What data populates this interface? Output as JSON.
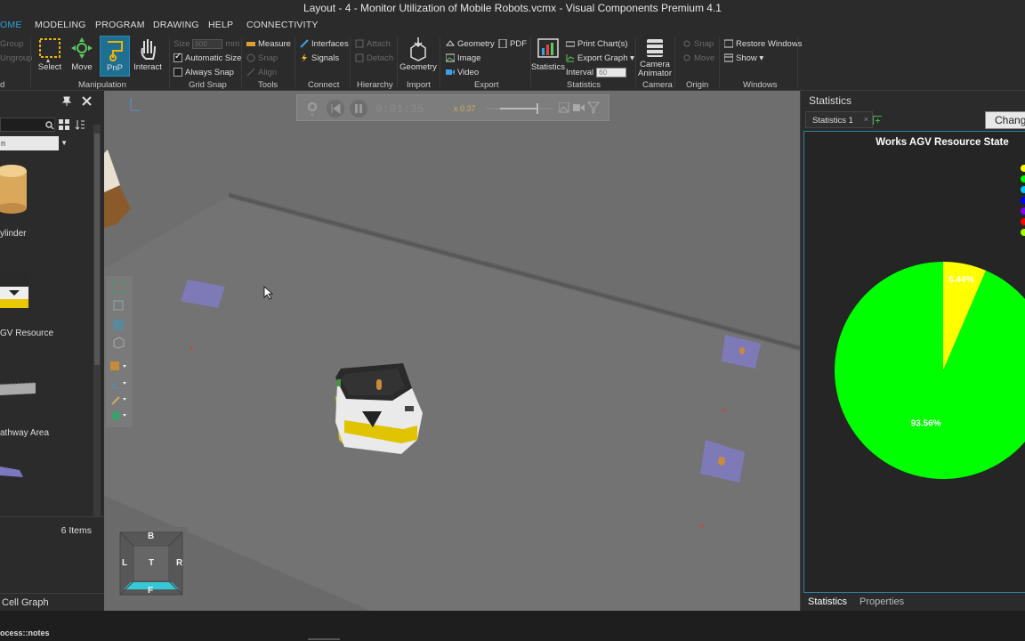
{
  "window": {
    "title": "Layout - 4 - Monitor Utilization of Mobile Robots.vcmx - Visual Components Premium 4.1"
  },
  "menu": {
    "tabs": [
      {
        "label": "OME"
      },
      {
        "label": "MODELING"
      },
      {
        "label": "PROGRAM"
      },
      {
        "label": "DRAWING"
      },
      {
        "label": "HELP"
      },
      {
        "label": "CONNECTIVITY"
      }
    ]
  },
  "ribbon": {
    "clipboard": {
      "group_label": "d",
      "group": "Group",
      "ungroup": "Ungroup"
    },
    "manipulation": {
      "group_label": "Manipulation",
      "select": "Select",
      "move": "Move",
      "pnp": "PnP",
      "interact": "Interact"
    },
    "grid_snap": {
      "group_label": "Grid Snap",
      "size_label": "Size",
      "size_value": "500",
      "size_unit": "mm",
      "automatic_size": "Automatic Size",
      "always_snap": "Always Snap"
    },
    "tools": {
      "group_label": "Tools",
      "measure": "Measure",
      "snap": "Snap",
      "align": "Align"
    },
    "connect": {
      "group_label": "Connect",
      "interfaces": "Interfaces",
      "signals": "Signals"
    },
    "hierarchy": {
      "group_label": "Hierarchy",
      "attach": "Attach",
      "detach": "Detach"
    },
    "import": {
      "group_label": "Import",
      "geometry": "Geometry"
    },
    "export": {
      "group_label": "Export",
      "geometry": "Geometry",
      "pdf": "PDF",
      "image": "Image",
      "video": "Video"
    },
    "statistics": {
      "group_label": "Statistics",
      "statistics": "Statistics",
      "print_charts": "Print Chart(s)",
      "export_graph": "Export Graph ▾",
      "interval_label": "Interval",
      "interval_value": "60",
      "interval_unit": "s"
    },
    "camera": {
      "group_label": "Camera",
      "camera_animator_line1": "Camera",
      "camera_animator_line2": "Animator"
    },
    "origin": {
      "group_label": "Origin",
      "snap": "Snap",
      "move": "Move"
    },
    "windows": {
      "group_label": "Windows",
      "restore_windows": "Restore Windows",
      "show": "Show ▾"
    }
  },
  "library": {
    "dropdown_value": "n",
    "items": [
      {
        "label": "ylinder"
      },
      {
        "label": "GV Resource"
      },
      {
        "label": "athway Area"
      }
    ],
    "items_count": "6 Items",
    "cell_graph": "Cell Graph"
  },
  "simulation": {
    "time": "0:01:35",
    "speed": "x 0.37"
  },
  "navcube": {
    "back": "B",
    "left": "L",
    "top": "T",
    "right": "R",
    "front": "F"
  },
  "statistics_panel": {
    "title": "Statistics",
    "tab_label": "Statistics 1",
    "change_button": "Chang",
    "bottom_tabs": [
      {
        "label": "Statistics"
      },
      {
        "label": "Properties"
      }
    ]
  },
  "chart_data": {
    "type": "pie",
    "title": "Works AGV Resource State",
    "slices": [
      {
        "value": 93.56,
        "label": "93.56%",
        "color": "#00ff00"
      },
      {
        "value": 6.44,
        "label": "6.44%",
        "color": "#ffff00"
      }
    ],
    "legend_colors": [
      "#ffff00",
      "#00ff00",
      "#00c8ff",
      "#0000ff",
      "#8000ff",
      "#ff0000",
      "#a0ff00"
    ],
    "legend_placement": "right"
  },
  "statusbar": {
    "text": "ocess::notes"
  }
}
